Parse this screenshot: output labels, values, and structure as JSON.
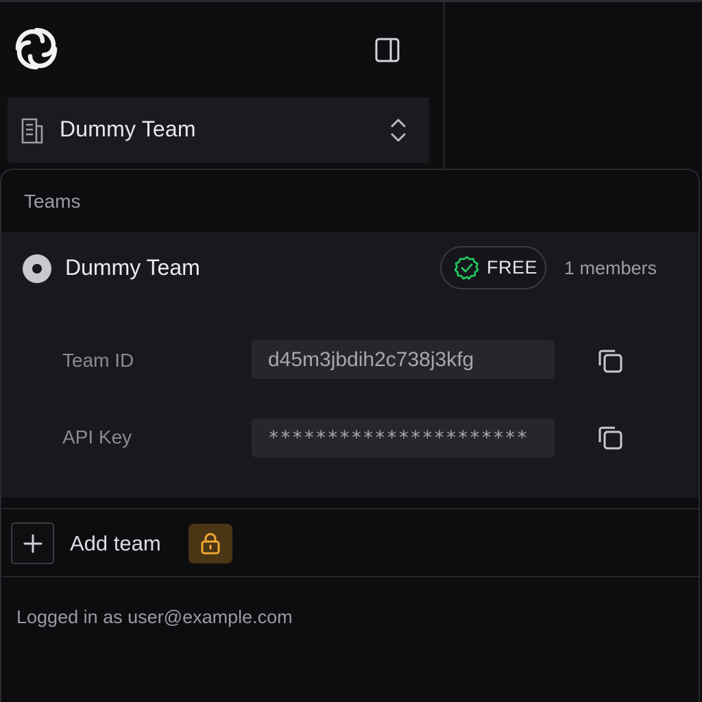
{
  "sidebar": {
    "logo_icon": "swirl-logo-icon",
    "toggle_icon": "sidebar-panel-icon",
    "team_switcher": {
      "icon": "document-icon",
      "name": "Dummy Team",
      "chevron_icon": "chevron-up-down-icon"
    }
  },
  "dropdown": {
    "section_label": "Teams",
    "team": {
      "name": "Dummy Team",
      "selected": true,
      "plan": "FREE",
      "plan_color": "#22c55e",
      "members": "1 members",
      "team_id_label": "Team ID",
      "team_id_value": "d45m3jbdih2c738j3kfg",
      "api_key_label": "API Key",
      "api_key_value": "**********************"
    },
    "add_team_label": "Add team",
    "lock_color": "#f0a830",
    "logged_in_text": "Logged in as user@example.com"
  }
}
